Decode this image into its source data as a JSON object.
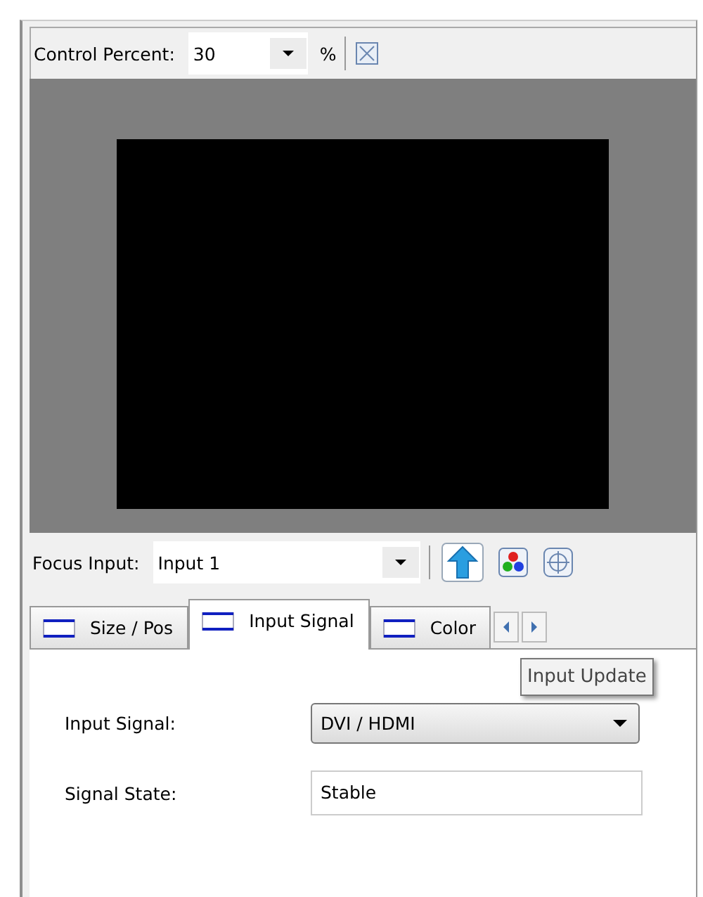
{
  "toolbar": {
    "label": "Control Percent:",
    "value": "30",
    "unit": "%"
  },
  "focus": {
    "label": "Focus Input:",
    "value": "Input 1"
  },
  "tabs": [
    {
      "label": "Size / Pos",
      "selected": false
    },
    {
      "label": "Input Signal",
      "selected": true
    },
    {
      "label": "Color",
      "selected": false
    }
  ],
  "tooltip": "Input Update",
  "fields": [
    {
      "kind": "dropdown",
      "label": "Input Signal:",
      "value": "DVI / HDMI"
    },
    {
      "kind": "text",
      "label": "Signal State:",
      "value": "Stable"
    }
  ]
}
